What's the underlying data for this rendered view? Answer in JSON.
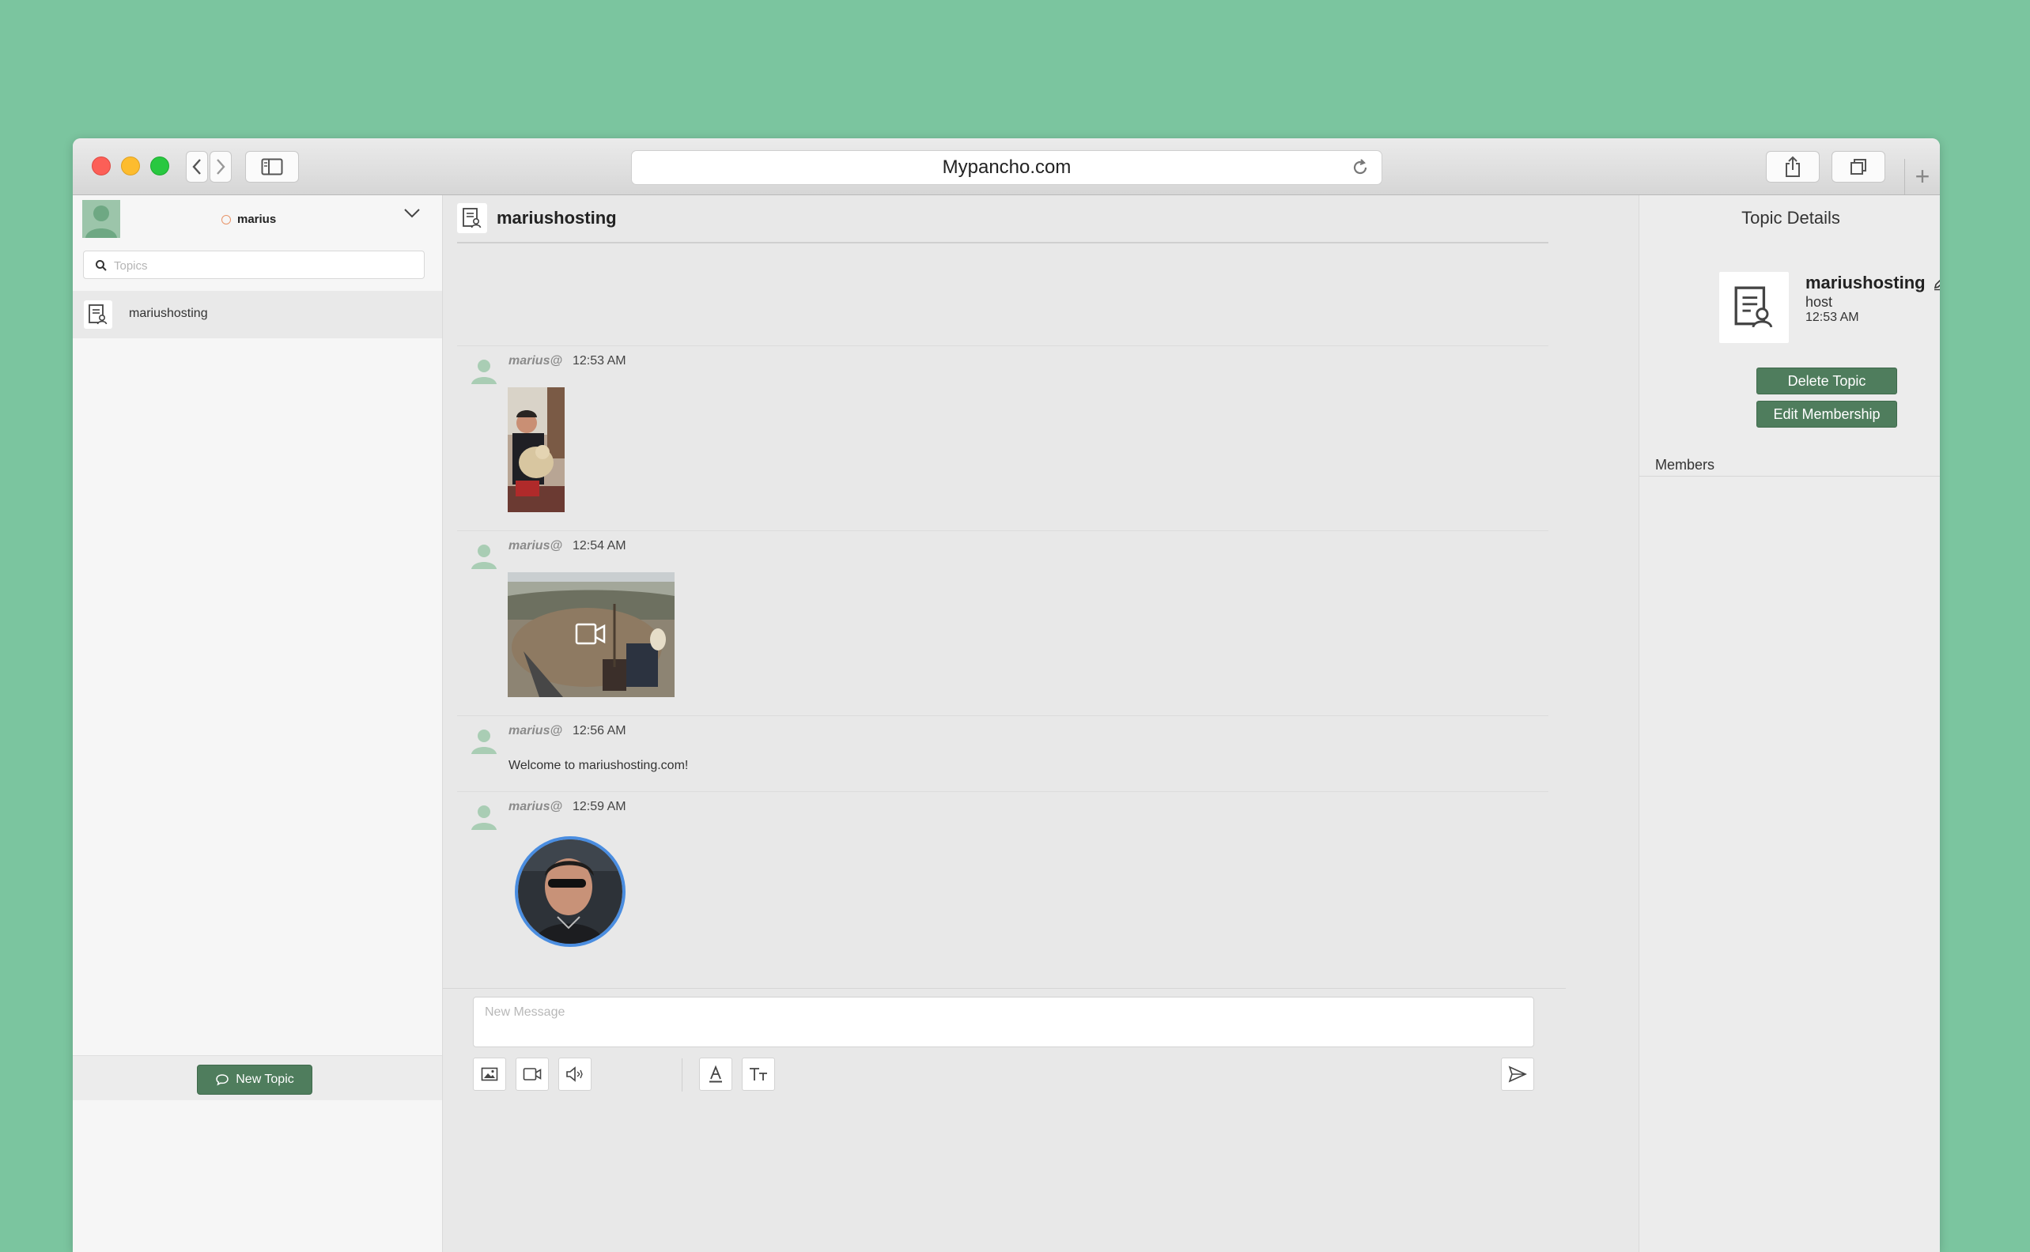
{
  "browser": {
    "url": "Mypancho.com"
  },
  "sidebar": {
    "user_name": "marius",
    "search_placeholder": "Topics",
    "topics": [
      {
        "label": "mariushosting"
      }
    ],
    "new_topic_label": "New Topic"
  },
  "chat": {
    "title": "mariushosting",
    "messages": [
      {
        "author": "marius@",
        "time": "12:53 AM",
        "kind": "image"
      },
      {
        "author": "marius@",
        "time": "12:54 AM",
        "kind": "video"
      },
      {
        "author": "marius@",
        "time": "12:56 AM",
        "kind": "text",
        "text": "Welcome to mariushosting.com!"
      },
      {
        "author": "marius@",
        "time": "12:59 AM",
        "kind": "round-video"
      }
    ],
    "composer": {
      "placeholder": "New Message"
    }
  },
  "details": {
    "title": "Topic Details",
    "topic_name": "mariushosting",
    "role": "host",
    "time": "12:53 AM",
    "delete_label": "Delete Topic",
    "edit_label": "Edit Membership",
    "members_label": "Members"
  },
  "colors": {
    "background": "#7bc59f",
    "accent_button": "#4f7d5d",
    "video_ring": "#4a8de0"
  }
}
